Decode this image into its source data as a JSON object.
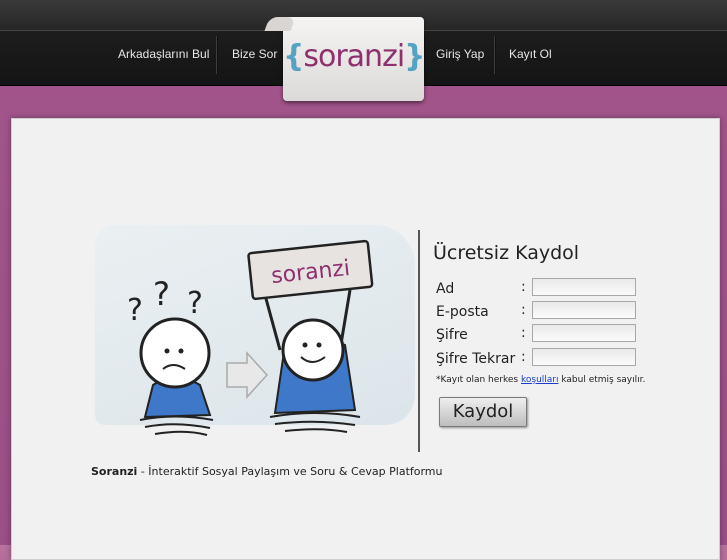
{
  "nav": {
    "items": [
      {
        "label": "Arkadaşlarını Bul"
      },
      {
        "label": "Bize Sor"
      },
      {
        "label": "Giriş Yap"
      },
      {
        "label": "Kayıt Ol"
      }
    ],
    "logo": {
      "open": "{",
      "word": "soranzi",
      "close": "}"
    }
  },
  "illustration": {
    "sign_text": "soranzi",
    "question_marks": "? ? ?"
  },
  "form": {
    "title": "Ücretsiz Kaydol",
    "fields": [
      {
        "label": "Ad",
        "value": ""
      },
      {
        "label": "E-posta",
        "value": ""
      },
      {
        "label": "Şifre",
        "value": ""
      },
      {
        "label": "Şifre Tekrar",
        "value": ""
      }
    ],
    "colon": ":",
    "terms_prefix": "*Kayıt olan herkes ",
    "terms_link": "koşulları",
    "terms_suffix": " kabul etmiş sayılır.",
    "submit_label": "Kaydol"
  },
  "footer": {
    "brand": "Soranzi",
    "tagline": " - İnteraktif Sosyal Paylaşım ve Soru & Cevap Platformu"
  },
  "colors": {
    "brand": "#8e2f6e",
    "accent": "#55a3c2",
    "background": "#a2558a"
  }
}
